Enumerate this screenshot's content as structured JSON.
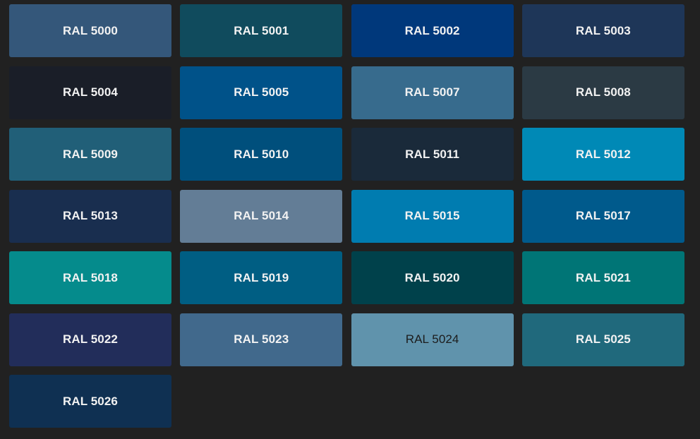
{
  "swatches": [
    {
      "label": "RAL 5000",
      "color": "#34577a",
      "text": "light"
    },
    {
      "label": "RAL 5001",
      "color": "#104b5d",
      "text": "light"
    },
    {
      "label": "RAL 5002",
      "color": "#00387b",
      "text": "light"
    },
    {
      "label": "RAL 5003",
      "color": "#1e3658",
      "text": "light"
    },
    {
      "label": "RAL 5004",
      "color": "#1a1e28",
      "text": "light"
    },
    {
      "label": "RAL 5005",
      "color": "#005289",
      "text": "light"
    },
    {
      "label": "RAL 5007",
      "color": "#376b8d",
      "text": "light"
    },
    {
      "label": "RAL 5008",
      "color": "#2b3a44",
      "text": "light"
    },
    {
      "label": "RAL 5009",
      "color": "#215f78",
      "text": "light"
    },
    {
      "label": "RAL 5010",
      "color": "#004f7c",
      "text": "light"
    },
    {
      "label": "RAL 5011",
      "color": "#1a2a3a",
      "text": "light"
    },
    {
      "label": "RAL 5012",
      "color": "#0089b6",
      "text": "light"
    },
    {
      "label": "RAL 5013",
      "color": "#192e4f",
      "text": "light"
    },
    {
      "label": "RAL 5014",
      "color": "#637d96",
      "text": "light"
    },
    {
      "label": "RAL 5015",
      "color": "#007cb0",
      "text": "light"
    },
    {
      "label": "RAL 5017",
      "color": "#005a8c",
      "text": "light"
    },
    {
      "label": "RAL 5018",
      "color": "#058b8c",
      "text": "light"
    },
    {
      "label": "RAL 5019",
      "color": "#005e83",
      "text": "light"
    },
    {
      "label": "RAL 5020",
      "color": "#00414b",
      "text": "light"
    },
    {
      "label": "RAL 5021",
      "color": "#007576",
      "text": "light"
    },
    {
      "label": "RAL 5022",
      "color": "#222d5a",
      "text": "light"
    },
    {
      "label": "RAL 5023",
      "color": "#41698c",
      "text": "light"
    },
    {
      "label": "RAL 5024",
      "color": "#6093ac",
      "text": "dark"
    },
    {
      "label": "RAL 5025",
      "color": "#20697c",
      "text": "light"
    },
    {
      "label": "RAL 5026",
      "color": "#0f3052",
      "text": "light"
    }
  ]
}
